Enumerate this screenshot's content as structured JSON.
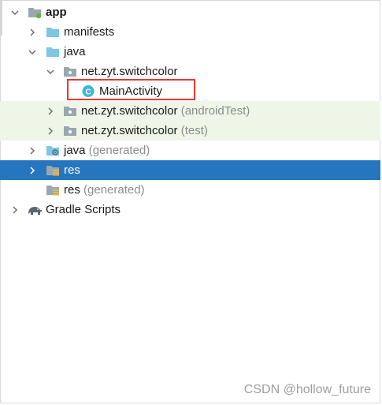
{
  "tree": {
    "app": {
      "label": "app"
    },
    "manifests": {
      "label": "manifests"
    },
    "java": {
      "label": "java"
    },
    "pkg_main": {
      "label": "net.zyt.switchcolor"
    },
    "main_activity": {
      "label": "MainActivity",
      "badge": "C"
    },
    "pkg_android_test": {
      "label": "net.zyt.switchcolor",
      "suffix": "(androidTest)"
    },
    "pkg_test": {
      "label": "net.zyt.switchcolor",
      "suffix": "(test)"
    },
    "java_generated": {
      "label": "java",
      "suffix": "(generated)"
    },
    "res": {
      "label": "res"
    },
    "res_generated": {
      "label": "res",
      "suffix": "(generated)"
    },
    "gradle_scripts": {
      "label": "Gradle Scripts"
    }
  },
  "watermark": "CSDN @hollow_future",
  "colors": {
    "selection": "#2675bf",
    "test_background": "#eff6e8",
    "highlight_border": "#e53935",
    "folder_blue": "#7cc6e6",
    "package_gray": "#9aa7b0"
  },
  "icons": {
    "expanded": "chevron-down-icon",
    "collapsed": "chevron-right-icon",
    "module": "module-folder-icon",
    "folder": "folder-icon",
    "package": "package-icon",
    "class": "class-icon",
    "gradle": "gradle-elephant-icon"
  }
}
